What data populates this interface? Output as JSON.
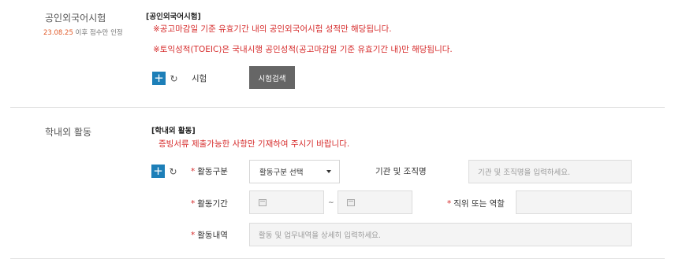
{
  "language_section": {
    "title": "공인외국어시험",
    "note_date": "23.08.25",
    "note_rest": " 이후 점수만 인정",
    "heading": "[공인외국어시험]",
    "notices": [
      "※공고마감일 기준 유효기간 내의 공인외국어시험 성적만 해당됩니다.",
      "※토익성적(TOEIC)은 국내시행 공인성적(공고마감일 기준 유효기간 내)만 해당됩니다."
    ],
    "plus_symbol": "+",
    "refresh_symbol": "↻",
    "exam_label": "시험",
    "exam_search_button": "시험검색"
  },
  "activity_section": {
    "title": "학내외 활동",
    "heading": "[학내외 활동]",
    "notice": "증빙서류 제출가능한 사항만 기재하여 주시기 바랍니다.",
    "plus_symbol": "+",
    "refresh_symbol": "↻",
    "required_mark": "*",
    "type_label": "활동구분",
    "type_select_value": "활동구분 선택",
    "org_label": "기관 및 조직명",
    "org_placeholder": "기관 및 조직명을 입력하세요.",
    "period_label": "활동기간",
    "period_separator": "~",
    "position_label": "직위 또는 역할",
    "content_label": "활동내역",
    "content_placeholder": "활동 및 업무내역을 상세히 입력하세요."
  }
}
